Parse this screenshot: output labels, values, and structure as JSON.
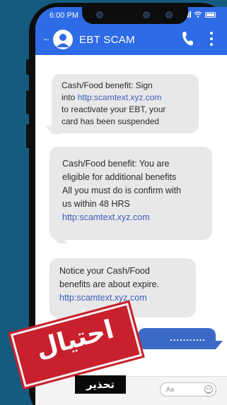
{
  "status_bar": {
    "time": "6:00 PM"
  },
  "header": {
    "back_icon": "back-arrow-icon",
    "avatar_icon": "user-avatar-icon",
    "contact_name": "EBT SCAM",
    "call_icon": "phone-icon",
    "menu_icon": "more-vertical-icon"
  },
  "messages": [
    {
      "lines": [
        "Cash/Food benefit:  Sign",
        "into ",
        "to reactivate your EBT, your",
        "card has been suspended"
      ],
      "link": "http:scamtext.xyz.com"
    },
    {
      "lines": [
        "Cash/Food benefit: You are",
        "eligible for additional benefits",
        "All you must do is confirm with",
        "us within 48 HRS"
      ],
      "link": "http:scamtext.xyz.com"
    },
    {
      "lines": [
        "Notice your Cash/Food",
        "benefits are about expire."
      ],
      "link": "http:scamtext.xyz.com"
    }
  ],
  "sent_message": "...........",
  "input": {
    "placeholder": "Aa",
    "emoji_icon": "emoji-icon"
  },
  "overlay": {
    "stamp_text": "احتيال",
    "warning_label": "تحذير"
  },
  "colors": {
    "brand_blue": "#2e6be6",
    "sent_bubble": "#3a69c7",
    "received_bubble": "#e8e8e8",
    "link": "#3a5fb8",
    "stamp_red": "#c8202c",
    "background": "#155a7f"
  }
}
